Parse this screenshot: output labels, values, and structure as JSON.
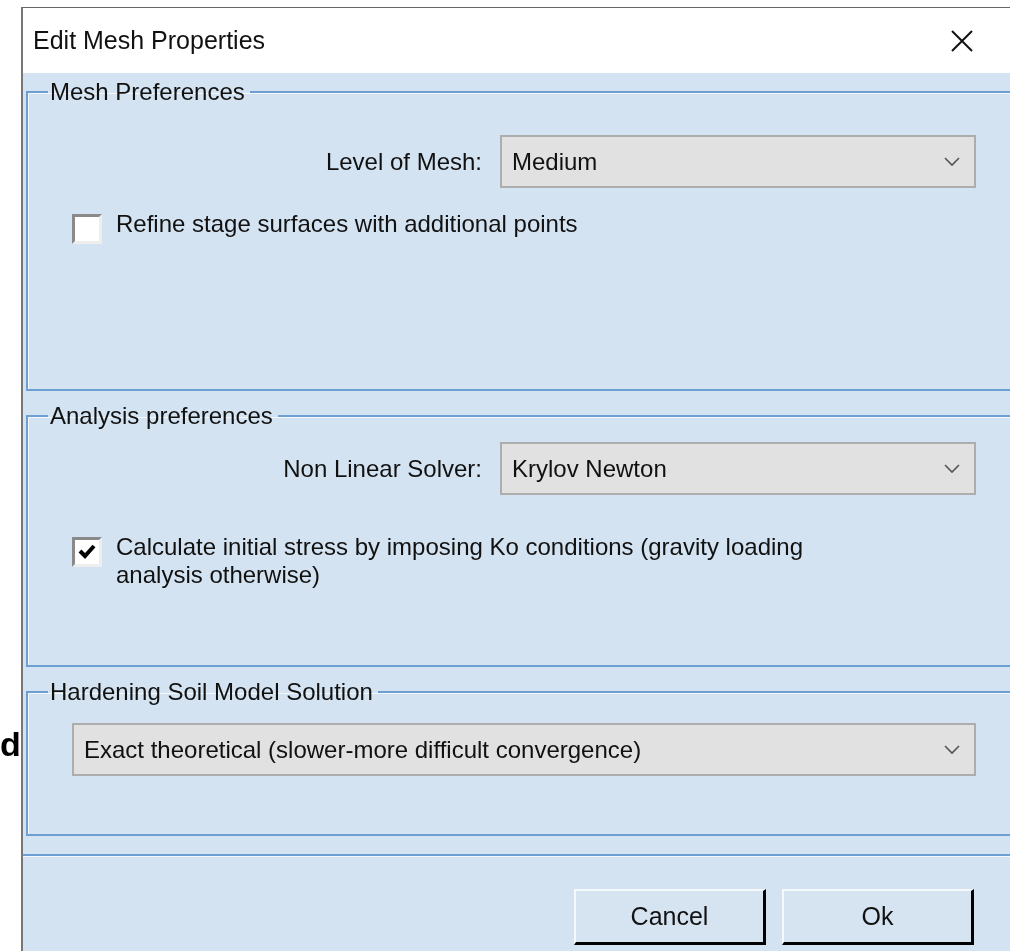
{
  "background_text": "d",
  "window": {
    "title": "Edit Mesh Properties"
  },
  "groups": [
    {
      "title": "Mesh Preferences",
      "items": [
        {
          "kind": "dropdown",
          "label": "Level of Mesh:",
          "value": "Medium"
        },
        {
          "kind": "checkbox",
          "label": "Refine stage surfaces with additional points",
          "checked": false
        }
      ]
    },
    {
      "title": "Analysis preferences",
      "items": [
        {
          "kind": "dropdown",
          "label": "Non Linear Solver:",
          "value": "Krylov Newton"
        },
        {
          "kind": "checkbox",
          "label": "Calculate initial stress by imposing Ko conditions (gravity loading analysis otherwise)",
          "checked": true
        }
      ]
    },
    {
      "title": "Hardening Soil Model Solution",
      "items": [
        {
          "kind": "dropdown",
          "value": "Exact theoretical (slower-more difficult convergence)"
        }
      ]
    }
  ],
  "buttons": [
    "Cancel",
    "Ok"
  ]
}
